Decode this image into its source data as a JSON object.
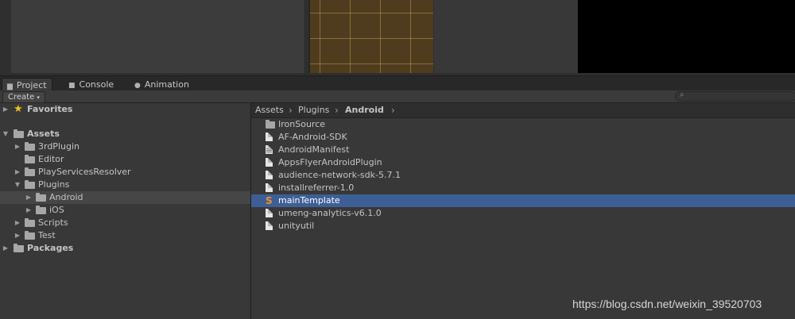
{
  "tabs": [
    {
      "label": "Project",
      "icon": "folder-icon",
      "active": true
    },
    {
      "label": "Console",
      "icon": "console-icon",
      "active": false
    },
    {
      "label": "Animation",
      "icon": "animation-icon",
      "active": false
    }
  ],
  "toolbar": {
    "create_label": "Create"
  },
  "tree": {
    "favorites": "Favorites",
    "assets": "Assets",
    "items": [
      "3rdPlugin",
      "Editor",
      "PlayServicesResolver",
      "Plugins",
      "Android",
      "iOS",
      "Scripts",
      "Test"
    ],
    "packages": "Packages"
  },
  "breadcrumb": {
    "items": [
      "Assets",
      "Plugins",
      "Android"
    ]
  },
  "files": [
    {
      "name": "IronSource",
      "icon": "folder-icon"
    },
    {
      "name": "AF-Android-SDK",
      "icon": "file-icon"
    },
    {
      "name": "AndroidManifest",
      "icon": "manifest-file-icon"
    },
    {
      "name": "AppsFlyerAndroidPlugin",
      "icon": "file-icon"
    },
    {
      "name": "audience-network-sdk-5.7.1",
      "icon": "file-icon"
    },
    {
      "name": "installreferrer-1.0",
      "icon": "file-icon"
    },
    {
      "name": "mainTemplate",
      "icon": "sublime-file-icon",
      "selected": true
    },
    {
      "name": "umeng-analytics-v6.1.0",
      "icon": "file-icon"
    },
    {
      "name": "unityutil",
      "icon": "file-icon"
    }
  ],
  "watermark": "https://blog.csdn.net/weixin_39520703",
  "colors": {
    "selection": "#3e5f96",
    "background": "#383838"
  }
}
